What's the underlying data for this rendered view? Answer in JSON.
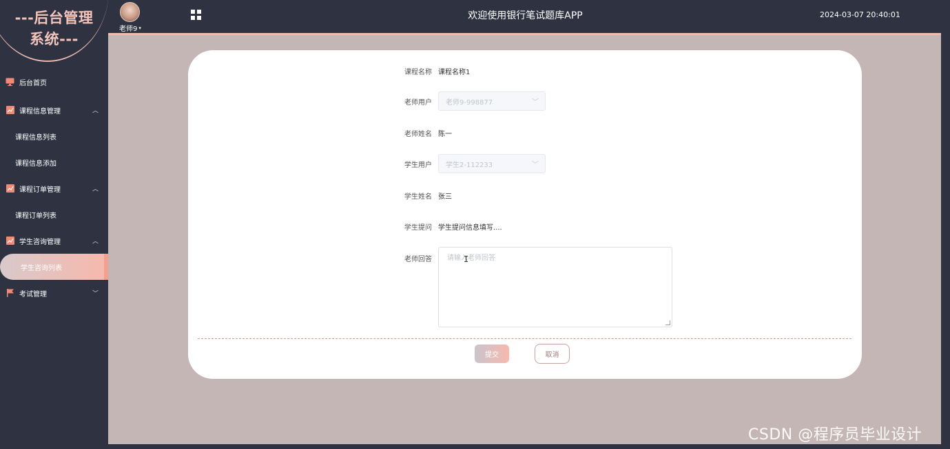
{
  "logo": {
    "line1": "---后台管理",
    "line2": "系统---"
  },
  "header": {
    "user_name": "老师9",
    "app_title": "欢迎使用银行笔试题库APP",
    "datetime": "2024-03-07 20:40:01"
  },
  "sidebar": {
    "items": [
      {
        "label": "后台首页",
        "icon": "monitor-icon"
      },
      {
        "label": "课程信息管理",
        "icon": "chart-icon",
        "expanded": true,
        "children": [
          "课程信息列表",
          "课程信息添加"
        ]
      },
      {
        "label": "课程订单管理",
        "icon": "chart-icon",
        "expanded": true,
        "children": [
          "课程订单列表"
        ]
      },
      {
        "label": "学生咨询管理",
        "icon": "chart-icon",
        "expanded": true,
        "children": [
          "学生咨询列表"
        ]
      },
      {
        "label": "考试管理",
        "icon": "flag-icon",
        "expanded": false
      }
    ],
    "active": "学生咨询列表"
  },
  "form": {
    "course_name": {
      "label": "课程名称",
      "value": "课程名称1"
    },
    "teacher_user": {
      "label": "老师用户",
      "value": "老师9-998877"
    },
    "teacher_name": {
      "label": "老师姓名",
      "value": "陈一"
    },
    "student_user": {
      "label": "学生用户",
      "value": "学生2-112233"
    },
    "student_name": {
      "label": "学生姓名",
      "value": "张三"
    },
    "student_question": {
      "label": "学生提问",
      "value": "学生提问信息填写...."
    },
    "teacher_answer": {
      "label": "老师回答",
      "placeholder": "请输入老师回答"
    },
    "submit_label": "提交",
    "cancel_label": "取消"
  },
  "colors": {
    "sidebar_bg": "#2f3341",
    "content_bg": "#c4b6b4",
    "accent": "#f4bcb1"
  },
  "watermark": "CSDN @程序员毕业设计"
}
